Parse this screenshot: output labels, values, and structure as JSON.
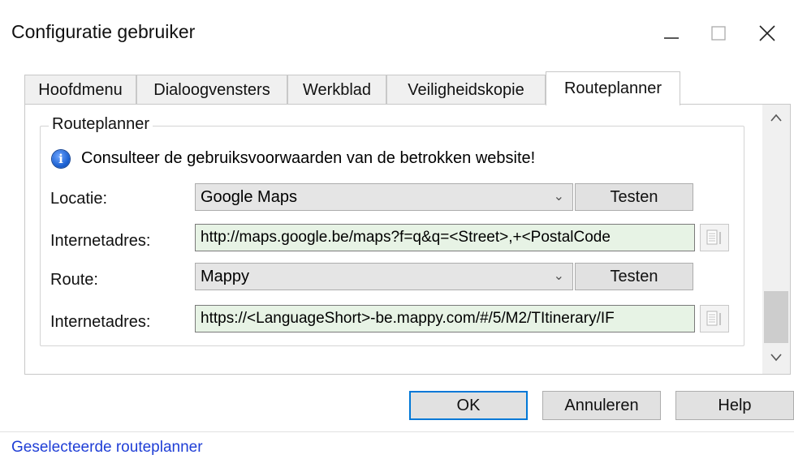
{
  "window": {
    "title": "Configuratie gebruiker",
    "icons": [
      "minimize-icon",
      "maximize-icon",
      "close-icon"
    ]
  },
  "tabs": [
    {
      "label": "Hoofdmenu",
      "active": false
    },
    {
      "label": "Dialoogvensters",
      "active": false
    },
    {
      "label": "Werkblad",
      "active": false
    },
    {
      "label": "Veiligheidskopie",
      "active": false
    },
    {
      "label": "Routeplanner",
      "active": true
    }
  ],
  "group": {
    "legend": "Routeplanner",
    "info": "Consulteer de gebruiksvoorwaarden van de betrokken website!"
  },
  "rows": {
    "locatie": {
      "label": "Locatie:",
      "value": "Google Maps",
      "test_label": "Testen"
    },
    "locatie_url": {
      "label": "Internetadres:",
      "value": "http://maps.google.be/maps?f=q&q=<Street>,+<PostalCode"
    },
    "route": {
      "label": "Route:",
      "value": "Mappy",
      "test_label": "Testen"
    },
    "route_url": {
      "label": "Internetadres:",
      "value": "https://<LanguageShort>-be.mappy.com/#/5/M2/TItinerary/IF"
    }
  },
  "footer": {
    "ok": "OK",
    "cancel": "Annuleren",
    "help": "Help"
  },
  "status": {
    "text": "Geselecteerde routeplanner"
  },
  "colors": {
    "url_background": "#e7f3e5",
    "status_link": "#1f3ed6",
    "default_button_border": "#0078d7"
  }
}
